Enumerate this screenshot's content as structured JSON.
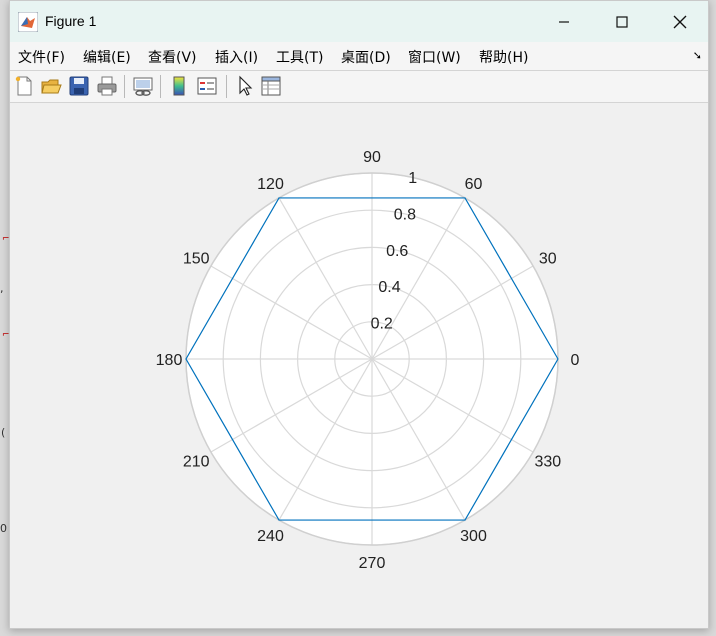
{
  "window": {
    "title": "Figure 1"
  },
  "menu": [
    {
      "label": "文件(F)"
    },
    {
      "label": "编辑(E)"
    },
    {
      "label": "查看(V)"
    },
    {
      "label": "插入(I)"
    },
    {
      "label": "工具(T)"
    },
    {
      "label": "桌面(D)"
    },
    {
      "label": "窗口(W)"
    },
    {
      "label": "帮助(H)"
    }
  ],
  "toolbar": [
    {
      "icon": "new-figure-icon"
    },
    {
      "icon": "open-file-icon"
    },
    {
      "icon": "save-icon"
    },
    {
      "icon": "print-icon"
    },
    {
      "icon": "link-plot-icon"
    },
    {
      "icon": "colorbar-icon"
    },
    {
      "icon": "legend-icon"
    },
    {
      "icon": "edit-plot-icon"
    },
    {
      "icon": "property-inspector-icon"
    }
  ],
  "background_fragments": [
    ",",
    "(",
    "0"
  ],
  "colors": {
    "series": "#0072bd",
    "grid": "#d9d9d9",
    "axes_bg": "#ffffff"
  },
  "chart_data": {
    "type": "line",
    "coordinate_system": "polar",
    "angular_ticks": [
      "0",
      "30",
      "60",
      "90",
      "120",
      "150",
      "180",
      "210",
      "240",
      "270",
      "300",
      "330"
    ],
    "radial_ticks": [
      "0.2",
      "0.4",
      "0.6",
      "0.8",
      "1"
    ],
    "rlim": [
      0,
      1
    ],
    "grid": true,
    "series": [
      {
        "theta_deg": [
          0,
          60,
          120,
          180,
          240,
          300,
          360
        ],
        "r": [
          1,
          1,
          1,
          1,
          1,
          1,
          1
        ]
      }
    ]
  }
}
